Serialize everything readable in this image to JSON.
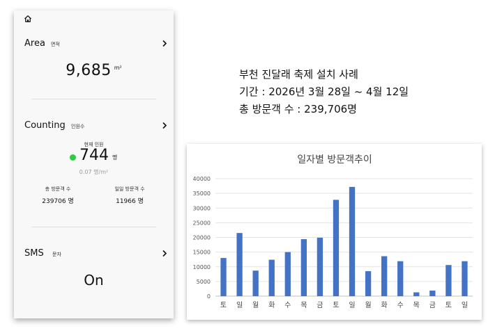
{
  "phone": {
    "area": {
      "title": "Area",
      "subtitle": "면적",
      "value": "9,685",
      "unit": "m²"
    },
    "counting": {
      "title": "Counting",
      "subtitle": "인원수",
      "current_label": "현재 인원",
      "current_value": "744",
      "current_unit": "명",
      "density": "0.07 명/m²",
      "total_label": "총 방문객 수",
      "total_value": "239706 명",
      "daily_label": "일일 방문객 수",
      "daily_value": "11966 명"
    },
    "sms": {
      "title": "SMS",
      "subtitle": "문자",
      "value": "On"
    }
  },
  "info": {
    "line1": "부천 진달래 축제 설치 사례",
    "line2": "기간 : 2026년 3월 28일 ~ 4월 12일",
    "line3": "총 방문객 수 : 239,706명"
  },
  "colors": {
    "bar": "#4472c4",
    "online_dot": "#2ecc40"
  },
  "chart_data": {
    "type": "bar",
    "title": "일자별 방문객추이",
    "categories": [
      "토",
      "일",
      "월",
      "화",
      "수",
      "목",
      "금",
      "토",
      "일",
      "월",
      "화",
      "수",
      "목",
      "금",
      "토",
      "일"
    ],
    "values": [
      13000,
      21500,
      8700,
      12400,
      15000,
      19400,
      19900,
      32800,
      37200,
      8500,
      13600,
      11900,
      1300,
      1900,
      10600,
      11900
    ],
    "ylim": [
      0,
      40000
    ],
    "yticks": [
      0,
      5000,
      10000,
      15000,
      20000,
      25000,
      30000,
      35000,
      40000
    ],
    "grid": true
  }
}
